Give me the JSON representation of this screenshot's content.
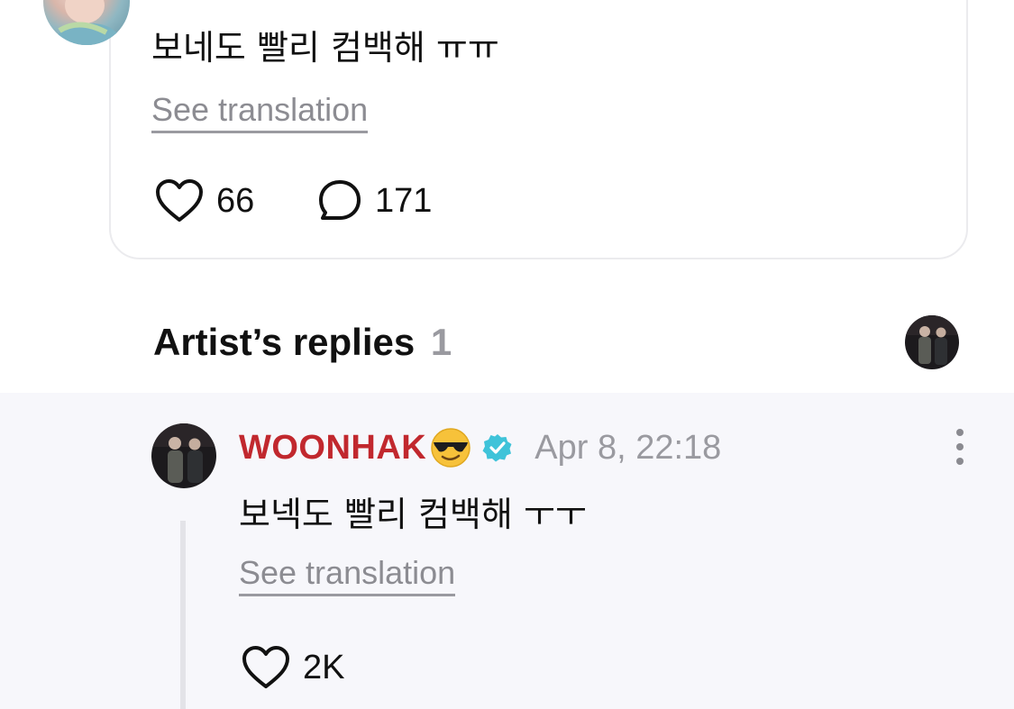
{
  "top_post": {
    "text": "보네도 빨리 컴백해 ㅠㅠ",
    "see_translation": "See translation",
    "likes": "66",
    "comments": "171",
    "avatar_icon": "user-avatar-photo"
  },
  "artist_replies": {
    "title": "Artist’s replies",
    "count": "1",
    "header_avatar_icon": "artist-avatar-photo"
  },
  "reply": {
    "author": "WOONHAK",
    "author_emoji": "😎",
    "verified_icon": "verified-badge-icon",
    "timestamp": "Apr 8, 22:18",
    "text": "보넥도 빨리 컴백해 ㅜㅜ",
    "see_translation": "See translation",
    "likes": "2K",
    "author_color": "#c1282e",
    "verified_color": "#3fc3d9"
  }
}
